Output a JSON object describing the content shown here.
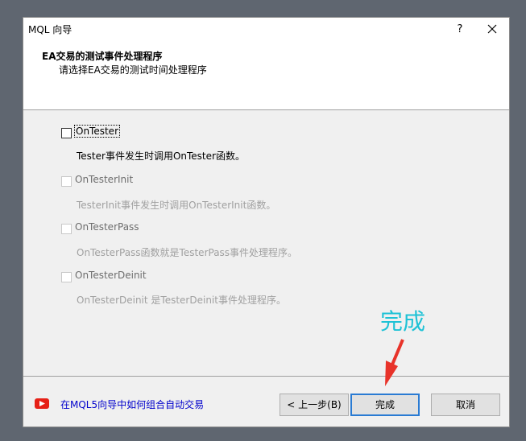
{
  "window": {
    "title": "MQL 向导",
    "help_label": "?"
  },
  "header": {
    "title": "EA交易的测试事件处理程序",
    "subtitle": "请选择EA交易的测试时间处理程序"
  },
  "options": [
    {
      "label": "OnTester",
      "description": "Tester事件发生时调用OnTester函数。",
      "checked": false,
      "enabled": true
    },
    {
      "label": "OnTesterInit",
      "description": "TesterInit事件发生时调用OnTesterInit函数。",
      "checked": false,
      "enabled": false
    },
    {
      "label": "OnTesterPass",
      "description": "OnTesterPass函数就是TesterPass事件处理程序。",
      "checked": false,
      "enabled": false
    },
    {
      "label": "OnTesterDeinit",
      "description": "OnTesterDeinit 是TesterDeinit事件处理程序。",
      "checked": false,
      "enabled": false
    }
  ],
  "footer": {
    "help_link": "在MQL5向导中如何组合自动交易",
    "back_label": "< 上一步(B)",
    "finish_label": "完成",
    "cancel_label": "取消"
  },
  "annotation": {
    "text": "完成",
    "color": "#1ec2d6",
    "arrow_color": "#e8332a"
  },
  "colors": {
    "link": "#0000cc",
    "default_button_border": "#2a7bd3",
    "youtube_red": "#e62117"
  },
  "icons": {
    "close": "close-icon",
    "video": "youtube-icon"
  }
}
